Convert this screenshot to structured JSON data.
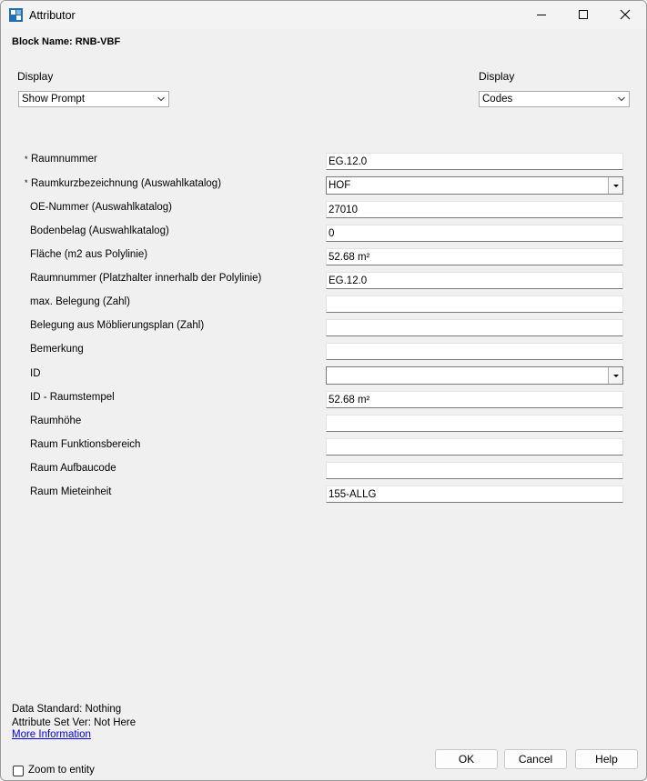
{
  "window": {
    "title": "Attributor"
  },
  "block_name": "Block Name: RNB-VBF",
  "display_left": {
    "label": "Display",
    "selected": "Show Prompt"
  },
  "display_right": {
    "label": "Display",
    "selected": "Codes"
  },
  "attributes": [
    {
      "label": "Raumnummer",
      "required": "*",
      "value": "EG.12.0"
    },
    {
      "label": "Raumkurzbezeichnung (Auswahlkatalog)",
      "required": "*",
      "value": "HOF"
    },
    {
      "label": "OE-Nummer (Auswahlkatalog)",
      "value": "27010"
    },
    {
      "label": "Bodenbelag (Auswahlkatalog)",
      "value": "0"
    },
    {
      "label": "Fläche (m2 aus Polylinie)",
      "value": "52.68 m²"
    },
    {
      "label": "Raumnummer (Platzhalter innerhalb der Polylinie)",
      "value": "EG.12.0"
    },
    {
      "label": "max. Belegung (Zahl)",
      "value": ""
    },
    {
      "label": "Belegung aus Möblierungsplan (Zahl)",
      "value": ""
    },
    {
      "label": "Bemerkung",
      "value": ""
    },
    {
      "label": "ID",
      "value": ""
    },
    {
      "label": "ID - Raumstempel",
      "value": "52.68 m²"
    },
    {
      "label": "Raumhöhe",
      "value": ""
    },
    {
      "label": "Raum Funktionsbereich",
      "value": ""
    },
    {
      "label": "Raum Aufbaucode",
      "value": ""
    },
    {
      "label": "Raum Mieteinheit",
      "value": "155-ALLG"
    }
  ],
  "footer": {
    "data_standard": "Data Standard: Nothing",
    "attribute_set": "Attribute Set Ver: Not Here",
    "more_info": "More Information",
    "zoom_label": "Zoom to entity"
  },
  "buttons": {
    "ok": "OK",
    "cancel": "Cancel",
    "help": "Help"
  }
}
